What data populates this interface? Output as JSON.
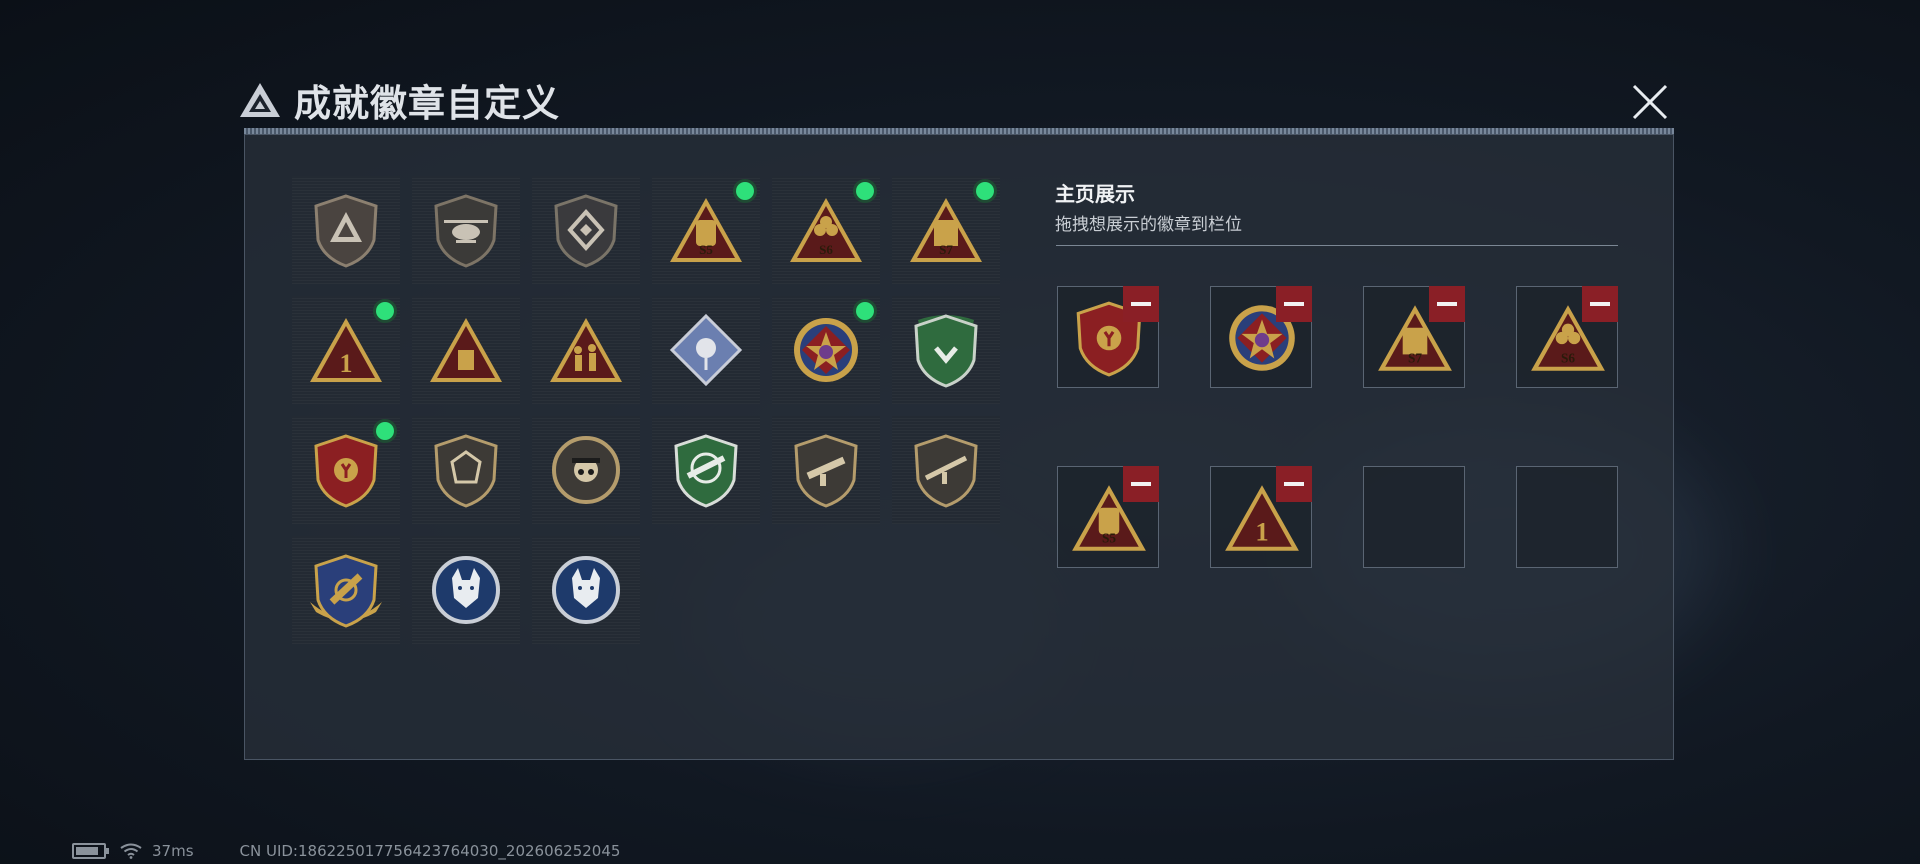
{
  "header": {
    "title": "成就徽章自定义"
  },
  "side": {
    "title": "主页展示",
    "subtitle": "拖拽想展示的徽章到栏位"
  },
  "status": {
    "ping": "37ms",
    "uid": "CN UID:186225017756423764030_202606252045"
  },
  "colors": {
    "accent_green": "#2ee07a",
    "remove_red": "#8a1f26",
    "gold": "#c9a24a",
    "dark_red": "#5a1a1a"
  },
  "badges": [
    {
      "icon": "triangle-logo-shield-icon",
      "selected": false
    },
    {
      "icon": "helicopter-shield-icon",
      "selected": false
    },
    {
      "icon": "diamond-emblem-shield-icon",
      "selected": false
    },
    {
      "icon": "s5-pack-triangle-icon",
      "label": "S5",
      "selected": true
    },
    {
      "icon": "s6-triangle-icon",
      "label": "S6",
      "selected": true
    },
    {
      "icon": "s7-triangle-icon",
      "label": "S7",
      "selected": true
    },
    {
      "icon": "number-one-triangle-icon",
      "label": "1",
      "selected": true
    },
    {
      "icon": "box-triangle-icon",
      "selected": false
    },
    {
      "icon": "soldiers-triangle-icon",
      "selected": false
    },
    {
      "icon": "rose-diamond-icon",
      "selected": false
    },
    {
      "icon": "star-medal-icon",
      "selected": true
    },
    {
      "icon": "green-shield-badge-icon",
      "selected": false
    },
    {
      "icon": "laurel-shield-badge-icon",
      "selected": true
    },
    {
      "icon": "gem-shield-icon",
      "selected": false
    },
    {
      "icon": "skull-circle-icon",
      "selected": false
    },
    {
      "icon": "rifle-green-shield-icon",
      "selected": false
    },
    {
      "icon": "smg-shield-icon",
      "selected": false
    },
    {
      "icon": "rifle-shield-icon",
      "selected": false
    },
    {
      "icon": "wings-shield-badge-icon",
      "selected": false
    },
    {
      "icon": "wolf-circle-icon",
      "selected": false
    },
    {
      "icon": "wolf-circle-icon",
      "selected": false
    }
  ],
  "slots": [
    {
      "icon": "laurel-shield-badge-icon"
    },
    {
      "icon": "star-medal-icon"
    },
    {
      "icon": "s7-triangle-icon",
      "label": "S7"
    },
    {
      "icon": "s6-triangle-icon",
      "label": "S6"
    },
    {
      "icon": "s5-pack-triangle-icon",
      "label": "S5"
    },
    {
      "icon": "number-one-triangle-icon",
      "label": "1"
    },
    {
      "icon": null
    },
    {
      "icon": null
    }
  ]
}
